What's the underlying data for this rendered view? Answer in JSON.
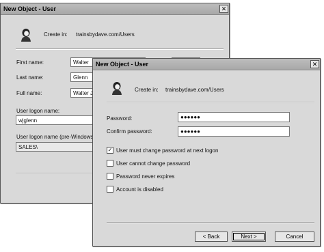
{
  "back_dialog": {
    "title": "New Object - User",
    "close_label": "✕",
    "create_in_label": "Create in:",
    "create_in_value": "trainsbydave.com/Users",
    "first_name_label": "First name:",
    "first_name_value": "Walter",
    "last_name_label": "Last name:",
    "last_name_value": "Glenn",
    "full_name_label": "Full name:",
    "full_name_value": "Walter J.",
    "logon_name_label": "User logon name:",
    "logon_name_value": "wjglenn",
    "pre_windows_label": "User logon name (pre-Windows",
    "pre_windows_value": "SALES\\"
  },
  "front_dialog": {
    "title": "New Object - User",
    "close_label": "✕",
    "create_in_label": "Create in:",
    "create_in_value": "trainsbydave.com/Users",
    "password_label": "Password:",
    "password_value": "●●●●●●",
    "confirm_label": "Confirm password:",
    "confirm_value": "●●●●●●",
    "options": [
      {
        "label": "User must change password at next logon",
        "checked": true
      },
      {
        "label": "User cannot change password",
        "checked": false
      },
      {
        "label": "Password never expires",
        "checked": false
      },
      {
        "label": "Account is disabled",
        "checked": false
      }
    ],
    "check_mark": "✓",
    "back_button": "< Back",
    "next_button": "Next >",
    "cancel_button": "Cancel"
  },
  "icon_names": [
    "user-icon"
  ]
}
